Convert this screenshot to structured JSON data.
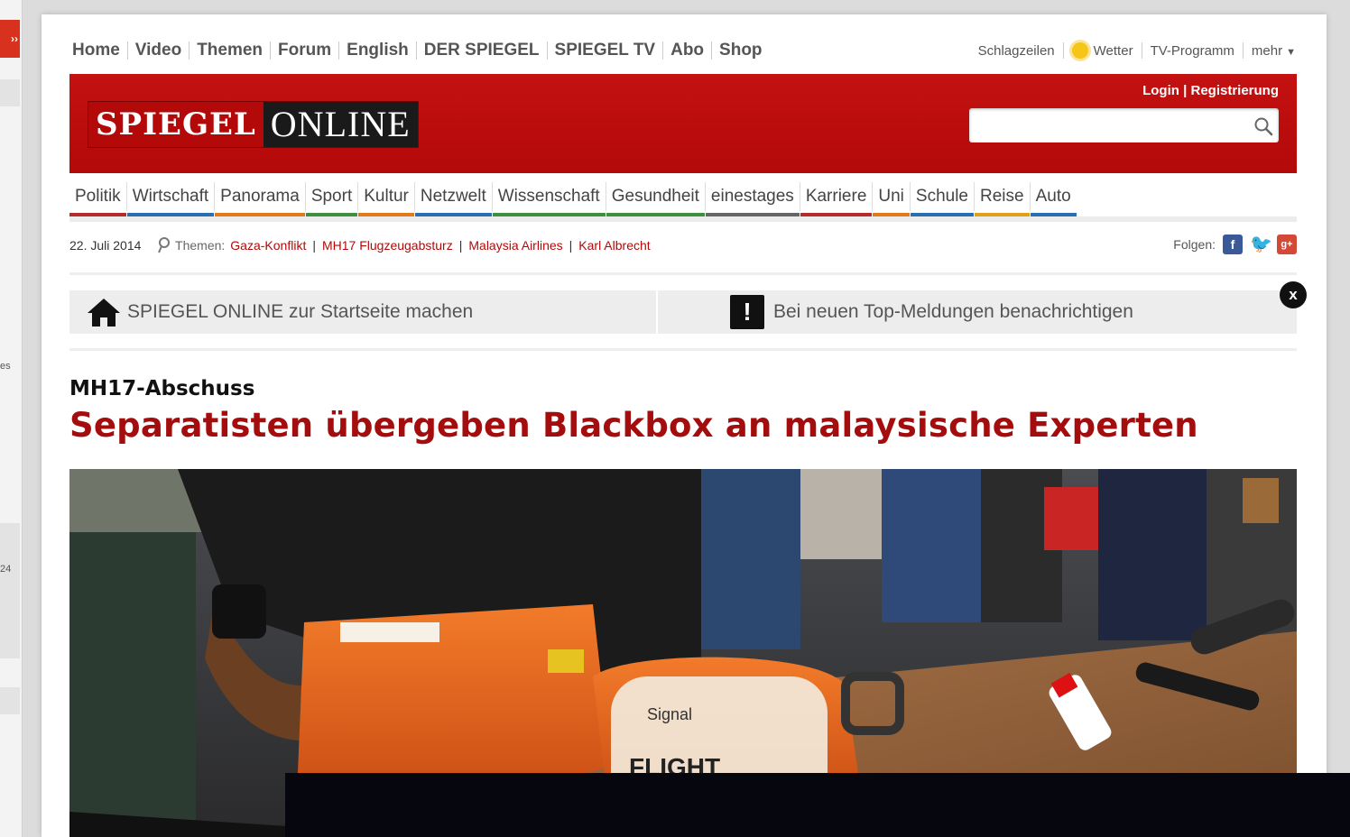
{
  "left_sliver": {
    "arrow": "››",
    "text1": "es",
    "text2": "24"
  },
  "top_nav": [
    "Home",
    "Video",
    "Themen",
    "Forum",
    "English",
    "DER SPIEGEL",
    "SPIEGEL TV",
    "Abo",
    "Shop"
  ],
  "right_nav": {
    "schlagzeilen": "Schlagzeilen",
    "wetter": "Wetter",
    "tv": "TV-Programm",
    "mehr": "mehr"
  },
  "header": {
    "logo_left": "SPIEGEL",
    "logo_right": "ONLINE",
    "login": "Login",
    "login_sep": "|",
    "register": "Registrierung",
    "search_placeholder": ""
  },
  "sections": [
    {
      "label": "Politik",
      "color": "#b52b2b"
    },
    {
      "label": "Wirtschaft",
      "color": "#2a6fb0"
    },
    {
      "label": "Panorama",
      "color": "#e07a1a"
    },
    {
      "label": "Sport",
      "color": "#3e8f3e"
    },
    {
      "label": "Kultur",
      "color": "#e07a1a"
    },
    {
      "label": "Netzwelt",
      "color": "#2a6fb0"
    },
    {
      "label": "Wissenschaft",
      "color": "#3e8f3e"
    },
    {
      "label": "Gesundheit",
      "color": "#3e8f3e"
    },
    {
      "label": "einestages",
      "color": "#666666"
    },
    {
      "label": "Karriere",
      "color": "#b52b2b"
    },
    {
      "label": "Uni",
      "color": "#e07a1a"
    },
    {
      "label": "Schule",
      "color": "#2a6fb0"
    },
    {
      "label": "Reise",
      "color": "#e0a01a"
    },
    {
      "label": "Auto",
      "color": "#2a6fb0"
    }
  ],
  "dateline": {
    "date": "22. Juli 2014",
    "themen_label": "Themen:",
    "topics": [
      "Gaza-Konflikt",
      "MH17 Flugzeugabsturz",
      "Malaysia Airlines",
      "Karl Albrecht"
    ],
    "folgen": "Folgen:"
  },
  "infobar": {
    "startpage": "SPIEGEL ONLINE zur Startseite machen",
    "notify": "Bei neuen Top-Meldungen benachrichtigen",
    "close": "x"
  },
  "article": {
    "kicker": "MH17-Abschuss",
    "headline": "Separatisten übergeben Blackbox an malaysische Experten",
    "photo_text1": "Signal",
    "photo_text2": "FLIGHT"
  },
  "colors": {
    "brand_red": "#b30909",
    "headline_red": "#a40d0d"
  }
}
